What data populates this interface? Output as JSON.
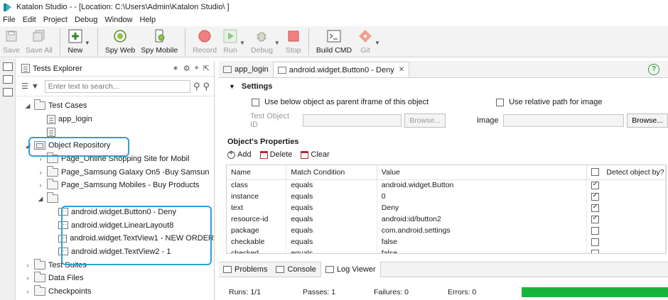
{
  "window": {
    "title": "Katalon Studio -          - [Location: C:\\Users\\Admin\\Katalon Studio\\          ]"
  },
  "menu": [
    "File",
    "Edit",
    "Project",
    "Debug",
    "Window",
    "Help"
  ],
  "toolbar": {
    "save": "Save",
    "save_all": "Save All",
    "new": "New",
    "spy_web": "Spy Web",
    "spy_mobile": "Spy Mobile",
    "record": "Record",
    "run": "Run",
    "debug": "Debug",
    "stop": "Stop",
    "build_cmd": "Build CMD",
    "git": "Git"
  },
  "explorer": {
    "title": "Tests Explorer",
    "search_placeholder": "Enter text to search...",
    "tree": {
      "test_cases": "Test Cases",
      "app_login": "app_login",
      "object_repository": "Object Repository",
      "page1": "Page_Online Shopping Site for Mobil",
      "page2": "Page_Samsung Galaxy On5 -Buy Samsun",
      "page3": "Page_Samsung Mobiles - Buy Products",
      "obj1": "android.widget.Button0 - Deny",
      "obj2": "android.widget.LinearLayout8",
      "obj3": "android.widget.TextView1 - NEW ORDER",
      "obj4": "android.widget.TextView2 - 1",
      "test_suites": "Test Suites",
      "data_files": "Data Files",
      "checkpoints": "Checkpoints"
    }
  },
  "editor": {
    "tabs": [
      "app_login",
      "android.widget.Button0 - Deny"
    ],
    "settings": {
      "title": "Settings",
      "use_parent_iframe": "Use below object as parent iframe of this object",
      "use_relative_path": "Use relative path for image",
      "test_object_id": "Test Object ID",
      "browse": "Browse...",
      "image": "Image"
    },
    "properties": {
      "title": "Object's Properties",
      "add": "Add",
      "delete": "Delete",
      "clear": "Clear",
      "columns": [
        "Name",
        "Match Condition",
        "Value",
        "Detect object by?"
      ],
      "rows": [
        {
          "name": "class",
          "cond": "equals",
          "value": "android.widget.Button",
          "detect": true
        },
        {
          "name": "instance",
          "cond": "equals",
          "value": "0",
          "detect": true
        },
        {
          "name": "text",
          "cond": "equals",
          "value": "Deny",
          "detect": true
        },
        {
          "name": "resource-id",
          "cond": "equals",
          "value": "android:id/button2",
          "detect": true
        },
        {
          "name": "package",
          "cond": "equals",
          "value": "com.android.settings",
          "detect": false
        },
        {
          "name": "checkable",
          "cond": "equals",
          "value": "false",
          "detect": false
        },
        {
          "name": "checked",
          "cond": "equals",
          "value": "false",
          "detect": false
        }
      ]
    }
  },
  "bottom": {
    "tabs": [
      "Problems",
      "Console",
      "Log Viewer"
    ],
    "status": {
      "runs": "Runs: 1/1",
      "passes": "Passes: 1",
      "failures": "Failures: 0",
      "errors": "Errors: 0"
    },
    "progress": 1.0,
    "progress_color": "#17b43c"
  }
}
